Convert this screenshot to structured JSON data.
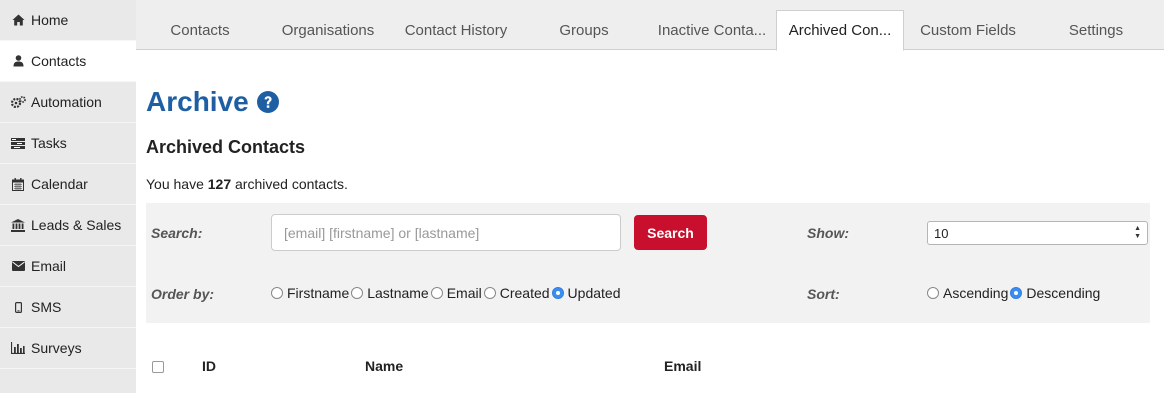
{
  "sidebar": {
    "items": [
      {
        "label": "Home",
        "icon": "home-icon"
      },
      {
        "label": "Contacts",
        "icon": "user-icon"
      },
      {
        "label": "Automation",
        "icon": "gears-icon"
      },
      {
        "label": "Tasks",
        "icon": "tasks-icon"
      },
      {
        "label": "Calendar",
        "icon": "calendar-icon"
      },
      {
        "label": "Leads & Sales",
        "icon": "bank-icon"
      },
      {
        "label": "Email",
        "icon": "envelope-icon"
      },
      {
        "label": "SMS",
        "icon": "mobile-icon"
      },
      {
        "label": "Surveys",
        "icon": "bar-chart-icon"
      }
    ],
    "active": "Contacts"
  },
  "tabs": [
    {
      "label": "Contacts"
    },
    {
      "label": "Organisations"
    },
    {
      "label": "Contact History"
    },
    {
      "label": "Groups"
    },
    {
      "label": "Inactive Conta..."
    },
    {
      "label": "Archived Con..."
    },
    {
      "label": "Custom Fields"
    },
    {
      "label": "Settings"
    }
  ],
  "active_tab": "Archived Con...",
  "page": {
    "title": "Archive",
    "section_title": "Archived Contacts",
    "count_prefix": "You have ",
    "count": "127",
    "count_suffix": " archived contacts."
  },
  "filters": {
    "search_label": "Search:",
    "search_placeholder": "[email] [firstname] or [lastname]",
    "search_value": "",
    "search_button": "Search",
    "show_label": "Show:",
    "show_value": "10",
    "order_label": "Order by:",
    "order_options": [
      "Firstname",
      "Lastname",
      "Email",
      "Created",
      "Updated"
    ],
    "order_selected": "Updated",
    "sort_label": "Sort:",
    "sort_options": [
      "Ascending",
      "Descending"
    ],
    "sort_selected": "Descending"
  },
  "table": {
    "columns": [
      "ID",
      "Name",
      "Email"
    ]
  },
  "colors": {
    "accent_title": "#1e5fa3",
    "search_button": "#c8102e",
    "radio_checked": "#3b8ef0"
  }
}
